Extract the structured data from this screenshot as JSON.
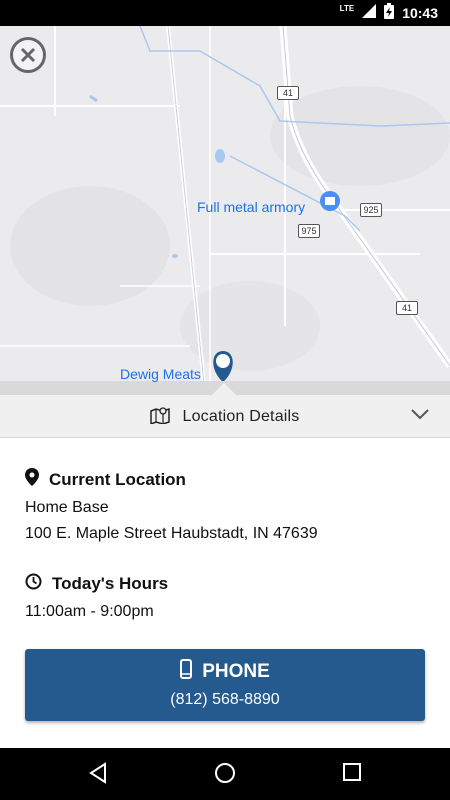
{
  "status_bar": {
    "network": "LTE",
    "time": "10:43"
  },
  "map": {
    "places": [
      {
        "name": "Full metal armory"
      },
      {
        "name": "Dewig Meats"
      }
    ],
    "route_shields": [
      "41",
      "925",
      "975",
      "41"
    ]
  },
  "details_header": {
    "title": "Location Details"
  },
  "current_location": {
    "heading": "Current Location",
    "name": "Home Base",
    "address": "100 E. Maple Street Haubstadt, IN 47639"
  },
  "hours": {
    "heading": "Today's Hours",
    "value": "11:00am - 9:00pm"
  },
  "phone": {
    "label": "PHONE",
    "number": "(812) 568-8890"
  },
  "colors": {
    "accent": "#255a8f",
    "map_label": "#1a73e8"
  }
}
